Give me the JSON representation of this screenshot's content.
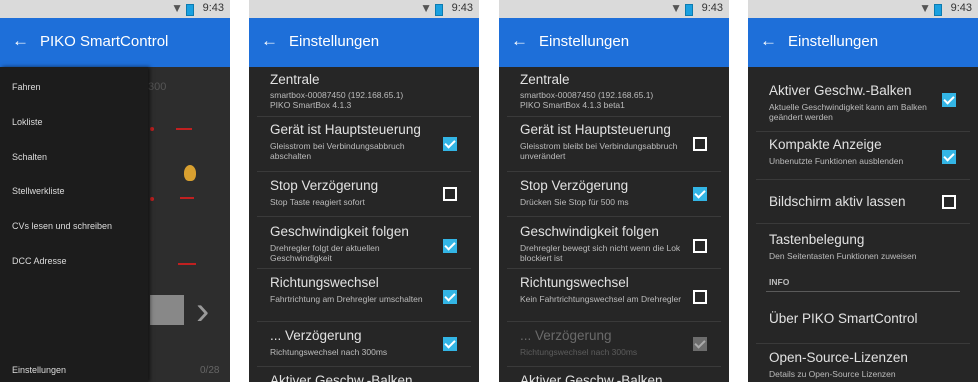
{
  "status": {
    "time": "9:43"
  },
  "panel1": {
    "title": "PIKO SmartControl",
    "drawer_items": [
      "Fahren",
      "Lokliste",
      "Schalten",
      "Stellwerkliste",
      "CVs lesen und schreiben",
      "DCC Adresse"
    ],
    "drawer_footer": "Einstellungen",
    "bg_number": "300",
    "bg_bottom": "0/28"
  },
  "panel2": {
    "title": "Einstellungen",
    "central_title": "Zentrale",
    "central_line1": "smartbox-00087450 (192.168.65.1)",
    "central_line2": "PIKO SmartBox 4.1.3",
    "rows": [
      {
        "title": "Gerät ist Hauptsteuerung",
        "subtitle": "Gleisstrom bei Verbindungsabbruch abschalten",
        "checked": true
      },
      {
        "title": "Stop Verzögerung",
        "subtitle": "Stop Taste reagiert sofort",
        "checked": false
      },
      {
        "title": "Geschwindigkeit folgen",
        "subtitle": "Drehregler folgt der aktuellen Geschwindigkeit",
        "checked": true
      },
      {
        "title": "Richtungswechsel",
        "subtitle": "Fahrtrichtung am Drehregler umschalten",
        "checked": true
      },
      {
        "title": "... Verzögerung",
        "subtitle": "Richtungswechsel nach 300ms",
        "checked": true
      },
      {
        "title": "Aktiver Geschw.-Balken",
        "subtitle": "",
        "checked": true
      }
    ]
  },
  "panel3": {
    "title": "Einstellungen",
    "central_title": "Zentrale",
    "central_line1": "smartbox-00087450 (192.168.65.1)",
    "central_line2": "PIKO SmartBox 4.1.3 beta1",
    "rows": [
      {
        "title": "Gerät ist Hauptsteuerung",
        "subtitle": "Gleisstrom bleibt bei Verbindungsabbruch unverändert",
        "checked": false
      },
      {
        "title": "Stop Verzögerung",
        "subtitle": "Drücken Sie Stop für 500 ms",
        "checked": true
      },
      {
        "title": "Geschwindigkeit folgen",
        "subtitle": "Drehregler bewegt sich nicht wenn die Lok blockiert ist",
        "checked": false
      },
      {
        "title": "Richtungswechsel",
        "subtitle": "Kein Fahrtrichtungswechsel am Drehregler",
        "checked": false
      },
      {
        "title": "... Verzögerung",
        "subtitle": "Richtungswechsel nach 300ms",
        "checked": true,
        "disabled": true
      },
      {
        "title": "Aktiver Geschw.-Balken",
        "subtitle": "",
        "checked": true
      }
    ]
  },
  "panel4": {
    "title": "Einstellungen",
    "rows": [
      {
        "title": "Aktiver Geschw.-Balken",
        "subtitle": "Aktuelle Geschwindigkeit kann am Balken geändert werden",
        "checked": true
      },
      {
        "title": "Kompakte Anzeige",
        "subtitle": "Unbenutzte Funktionen ausblenden",
        "checked": true
      },
      {
        "title": "Bildschirm aktiv lassen",
        "subtitle": "",
        "checked": false
      },
      {
        "title": "Tastenbelegung",
        "subtitle": "Den Seitentasten Funktionen zuweisen"
      }
    ],
    "section": "INFO",
    "info_rows": [
      {
        "title": "Über PIKO SmartControl",
        "subtitle": ""
      },
      {
        "title": "Open-Source-Lizenzen",
        "subtitle": "Details zu Open-Source Lizenzen"
      }
    ]
  }
}
